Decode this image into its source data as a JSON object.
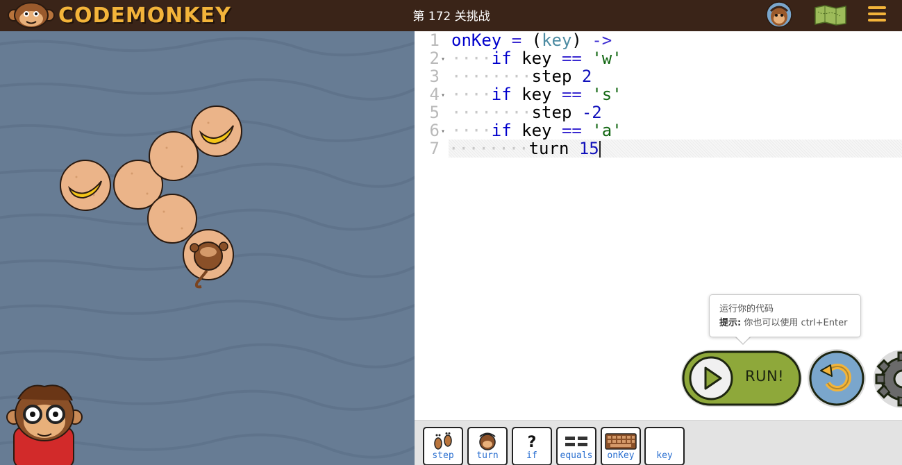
{
  "header": {
    "logo_text": "CODEMONKEY",
    "level_title": "第 172 关挑战",
    "icons": [
      "monkey-logo-icon",
      "profile-avatar-icon",
      "map-icon",
      "hamburger-menu-icon"
    ],
    "accent_color": "#f3b43a",
    "background_color": "#3a2418"
  },
  "stage": {
    "background_color": "#677c94"
  },
  "editor": {
    "lines": [
      {
        "num": "1",
        "dots": "",
        "tokens": [
          {
            "t": "onKey",
            "c": "kw"
          },
          {
            "t": " = ",
            "c": "op"
          },
          {
            "t": "(",
            "c": ""
          },
          {
            "t": "key",
            "c": "param"
          },
          {
            "t": ") ",
            "c": ""
          },
          {
            "t": "->",
            "c": "op"
          }
        ]
      },
      {
        "num": "2",
        "dots": "····",
        "tokens": [
          {
            "t": "if",
            "c": "kw"
          },
          {
            "t": " key ",
            "c": ""
          },
          {
            "t": "==",
            "c": "op"
          },
          {
            "t": " ",
            "c": ""
          },
          {
            "t": "'w'",
            "c": "str"
          }
        ]
      },
      {
        "num": "3",
        "dots": "········",
        "tokens": [
          {
            "t": "step ",
            "c": ""
          },
          {
            "t": "2",
            "c": "num"
          }
        ]
      },
      {
        "num": "4",
        "dots": "····",
        "tokens": [
          {
            "t": "if",
            "c": "kw"
          },
          {
            "t": " key ",
            "c": ""
          },
          {
            "t": "==",
            "c": "op"
          },
          {
            "t": " ",
            "c": ""
          },
          {
            "t": "'s'",
            "c": "str"
          }
        ]
      },
      {
        "num": "5",
        "dots": "········",
        "tokens": [
          {
            "t": "step ",
            "c": ""
          },
          {
            "t": "-2",
            "c": "num"
          }
        ]
      },
      {
        "num": "6",
        "dots": "····",
        "tokens": [
          {
            "t": "if",
            "c": "kw"
          },
          {
            "t": " key ",
            "c": ""
          },
          {
            "t": "==",
            "c": "op"
          },
          {
            "t": " ",
            "c": ""
          },
          {
            "t": "'a'",
            "c": "str"
          }
        ]
      },
      {
        "num": "7",
        "dots": "········",
        "tokens": [
          {
            "t": "turn ",
            "c": ""
          },
          {
            "t": "15",
            "c": "num"
          }
        ]
      }
    ]
  },
  "tooltip": {
    "line1": "运行你的代码",
    "hint_label": "提示:",
    "hint_text": " 你也可以使用 ctrl+Enter"
  },
  "controls": {
    "run_label": "RUN!",
    "run_color": "#8ea83a",
    "reset_color": "#7aa6cc"
  },
  "toolbox": {
    "items": [
      {
        "label": "step",
        "icon": "footprints-icon"
      },
      {
        "label": "turn",
        "icon": "monkey-head-turn-icon"
      },
      {
        "label": "if",
        "icon": "question-mark-icon"
      },
      {
        "label": "equals",
        "icon": "equals-icon"
      },
      {
        "label": "onKey",
        "icon": "keyboard-icon"
      },
      {
        "label": "key",
        "icon": ""
      }
    ]
  }
}
